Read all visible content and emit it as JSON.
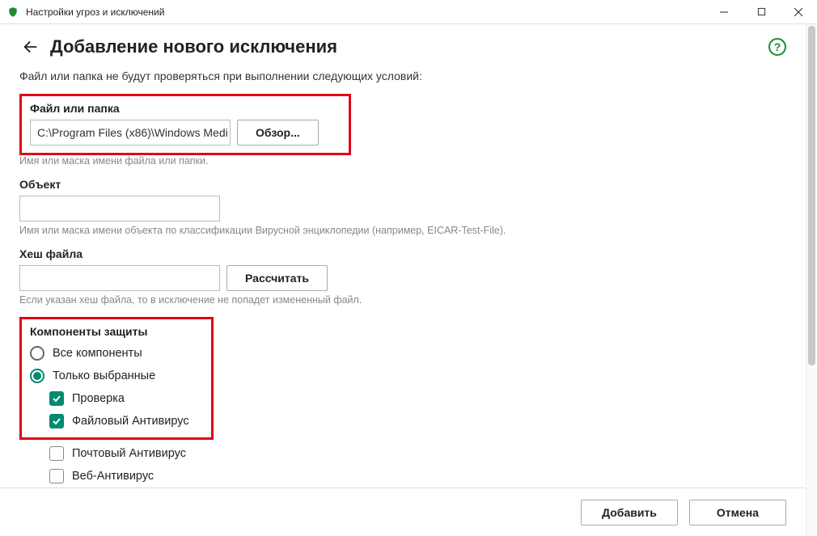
{
  "window": {
    "title": "Настройки угроз и исключений"
  },
  "page": {
    "title": "Добавление нового исключения",
    "intro": "Файл или папка не будут проверяться при выполнении следующих условий:"
  },
  "fileOrFolder": {
    "label": "Файл или папка",
    "value": "C:\\Program Files (x86)\\Windows Medi",
    "browse": "Обзор...",
    "hint": "Имя или маска имени файла или папки."
  },
  "object": {
    "label": "Объект",
    "value": "",
    "hint": "Имя или маска имени объекта по классификации Вирусной энциклопедии (например, EICAR-Test-File)."
  },
  "hash": {
    "label": "Хеш файла",
    "value": "",
    "calc": "Рассчитать",
    "hint": "Если указан хеш файла, то в исключение не попадет измененный файл."
  },
  "components": {
    "label": "Компоненты защиты",
    "radioAll": "Все компоненты",
    "radioSelected": "Только выбранные",
    "items": [
      {
        "label": "Проверка",
        "checked": true
      },
      {
        "label": "Файловый Антивирус",
        "checked": true
      },
      {
        "label": "Почтовый Антивирус",
        "checked": false
      },
      {
        "label": "Веб-Антивирус",
        "checked": false
      }
    ]
  },
  "footer": {
    "add": "Добавить",
    "cancel": "Отмена"
  }
}
